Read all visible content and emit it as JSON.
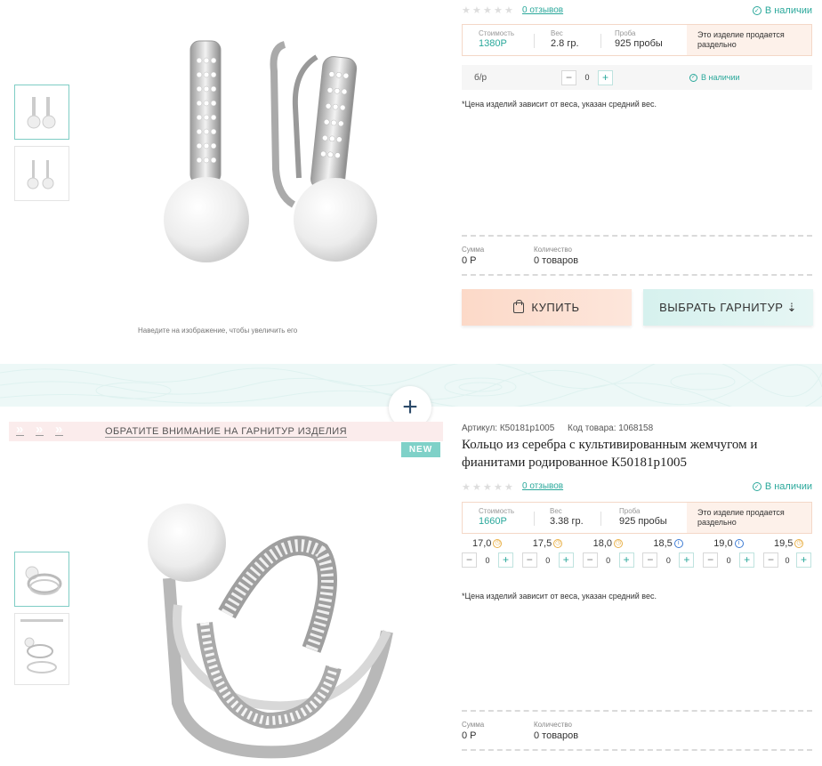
{
  "product1": {
    "reviews": "0 отзывов",
    "stock": "В наличии",
    "info": {
      "price_label": "Стоимость",
      "price": "1380Р",
      "weight_label": "Вес",
      "weight": "2.8 гр.",
      "probe_label": "Проба",
      "probe": "925 пробы",
      "note": "Это изделие продается раздельно"
    },
    "variant": {
      "label": "б/р",
      "qty": "0",
      "stock": "В наличии"
    },
    "price_note": "*Цена изделий зависит от веса, указан средний вес.",
    "sum_label": "Сумма",
    "sum": "0 Р",
    "qty_label": "Количество",
    "qty": "0 товаров",
    "zoom_hint": "Наведите на изображение, чтобы увеличить его",
    "buy_label": "КУПИТЬ",
    "set_label": "ВЫБРАТЬ ГАРНИТУР ⇣"
  },
  "band": {
    "add_symbol": "+"
  },
  "product2": {
    "set_banner": "ОБРАТИТЕ ВНИМАНИЕ НА ГАРНИТУР ИЗДЕЛИЯ",
    "badge": "NEW",
    "article": "Артикул: К50181р1005",
    "code": "Код товара: 1068158",
    "title": "Кольцо из серебра с культивированным жемчугом и фианитами родированное К50181р1005",
    "reviews": "0 отзывов",
    "stock": "В наличии",
    "info": {
      "price_label": "Стоимость",
      "price": "1660Р",
      "weight_label": "Вес",
      "weight": "3.38 гр.",
      "probe_label": "Проба",
      "probe": "925 пробы",
      "note": "Это изделие продается раздельно"
    },
    "sizes": [
      {
        "size": "17,0",
        "qty": "0",
        "icon": "clock-icon"
      },
      {
        "size": "17,5",
        "qty": "0",
        "icon": "clock-icon"
      },
      {
        "size": "18,0",
        "qty": "0",
        "icon": "clock-icon"
      },
      {
        "size": "18,5",
        "qty": "0",
        "icon": "info-icon"
      },
      {
        "size": "19,0",
        "qty": "0",
        "icon": "info-icon"
      },
      {
        "size": "19,5",
        "qty": "0",
        "icon": "clock-icon"
      }
    ],
    "price_note": "*Цена изделий зависит от веса, указан средний вес.",
    "sum_label": "Сумма",
    "sum": "0 Р",
    "qty_label": "Количество",
    "qty": "0 товаров"
  },
  "colors": {
    "accent": "#2aa89b",
    "buy": "#fcd9c8",
    "set": "#d6f1ee"
  }
}
